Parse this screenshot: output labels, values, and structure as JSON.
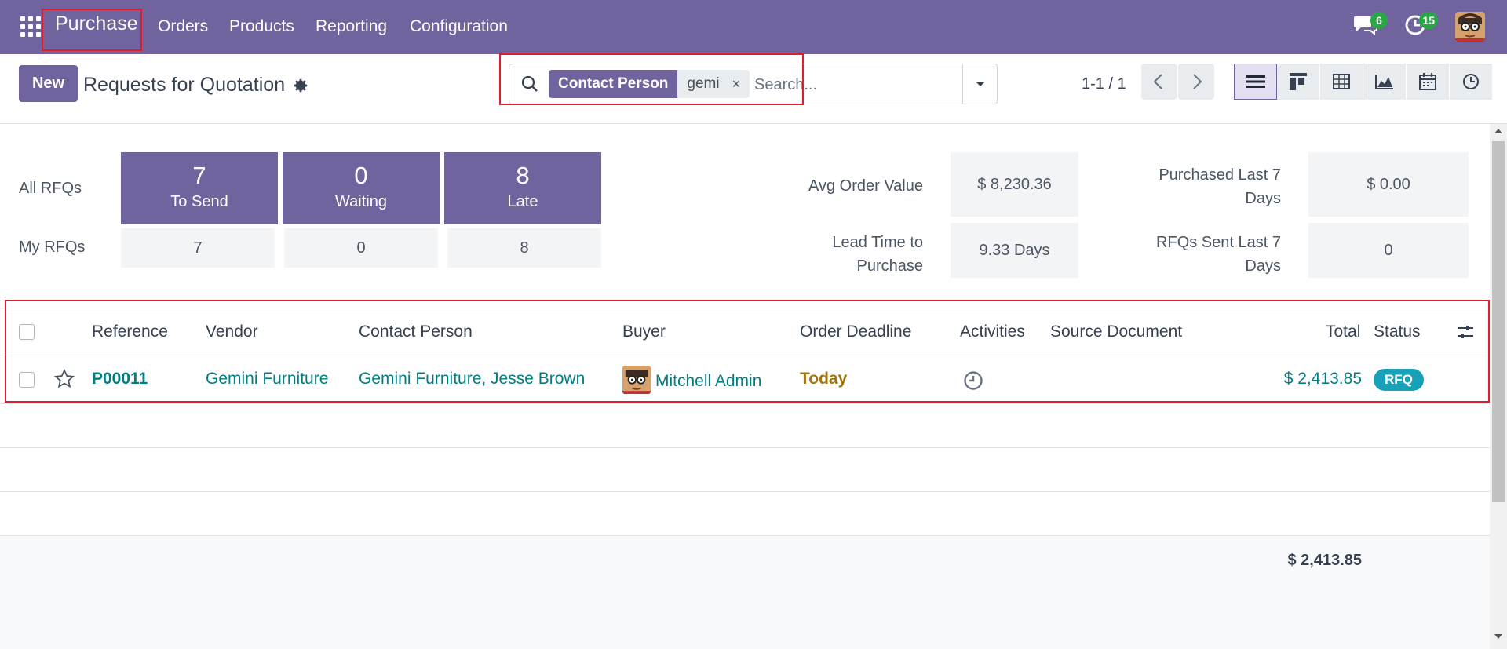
{
  "nav": {
    "app_name": "Purchase",
    "items": [
      "Orders",
      "Products",
      "Reporting",
      "Configuration"
    ],
    "messages_count": "6",
    "activities_count": "15"
  },
  "control": {
    "new_label": "New",
    "title": "Requests for Quotation",
    "search": {
      "facet_name": "Contact Person",
      "facet_value": "gemi",
      "remove_glyph": "×",
      "placeholder": "Search..."
    },
    "pager": "1-1 / 1"
  },
  "dashboard": {
    "all_label": "All RFQs",
    "my_label": "My RFQs",
    "tiles": [
      {
        "num": "7",
        "label": "To Send"
      },
      {
        "num": "0",
        "label": "Waiting"
      },
      {
        "num": "8",
        "label": "Late"
      }
    ],
    "my": [
      "7",
      "0",
      "8"
    ],
    "stats": {
      "avg_order_label": "Avg Order Value",
      "avg_order_value": "$ 8,230.36",
      "lead_time_label_1": "Lead Time to",
      "lead_time_label_2": "Purchase",
      "lead_time_value": "9.33 Days",
      "purchased_label_1": "Purchased Last 7",
      "purchased_label_2": "Days",
      "purchased_value": "$ 0.00",
      "sent_label_1": "RFQs Sent Last 7",
      "sent_label_2": "Days",
      "sent_value": "0"
    }
  },
  "table": {
    "headers": {
      "reference": "Reference",
      "vendor": "Vendor",
      "contact": "Contact Person",
      "buyer": "Buyer",
      "deadline": "Order Deadline",
      "activities": "Activities",
      "source": "Source Document",
      "total": "Total",
      "status": "Status"
    },
    "rows": [
      {
        "reference": "P00011",
        "vendor": "Gemini Furniture",
        "contact": "Gemini Furniture, Jesse Brown",
        "buyer": "Mitchell Admin",
        "deadline": "Today",
        "total": "$ 2,413.85",
        "status": "RFQ"
      }
    ],
    "sum_total": "$ 2,413.85"
  },
  "colors": {
    "brand": "#71639e",
    "link": "#017e84",
    "deadline_today": "#a1740c",
    "status_rfq": "#17a2b8",
    "badge": "#28a745"
  }
}
